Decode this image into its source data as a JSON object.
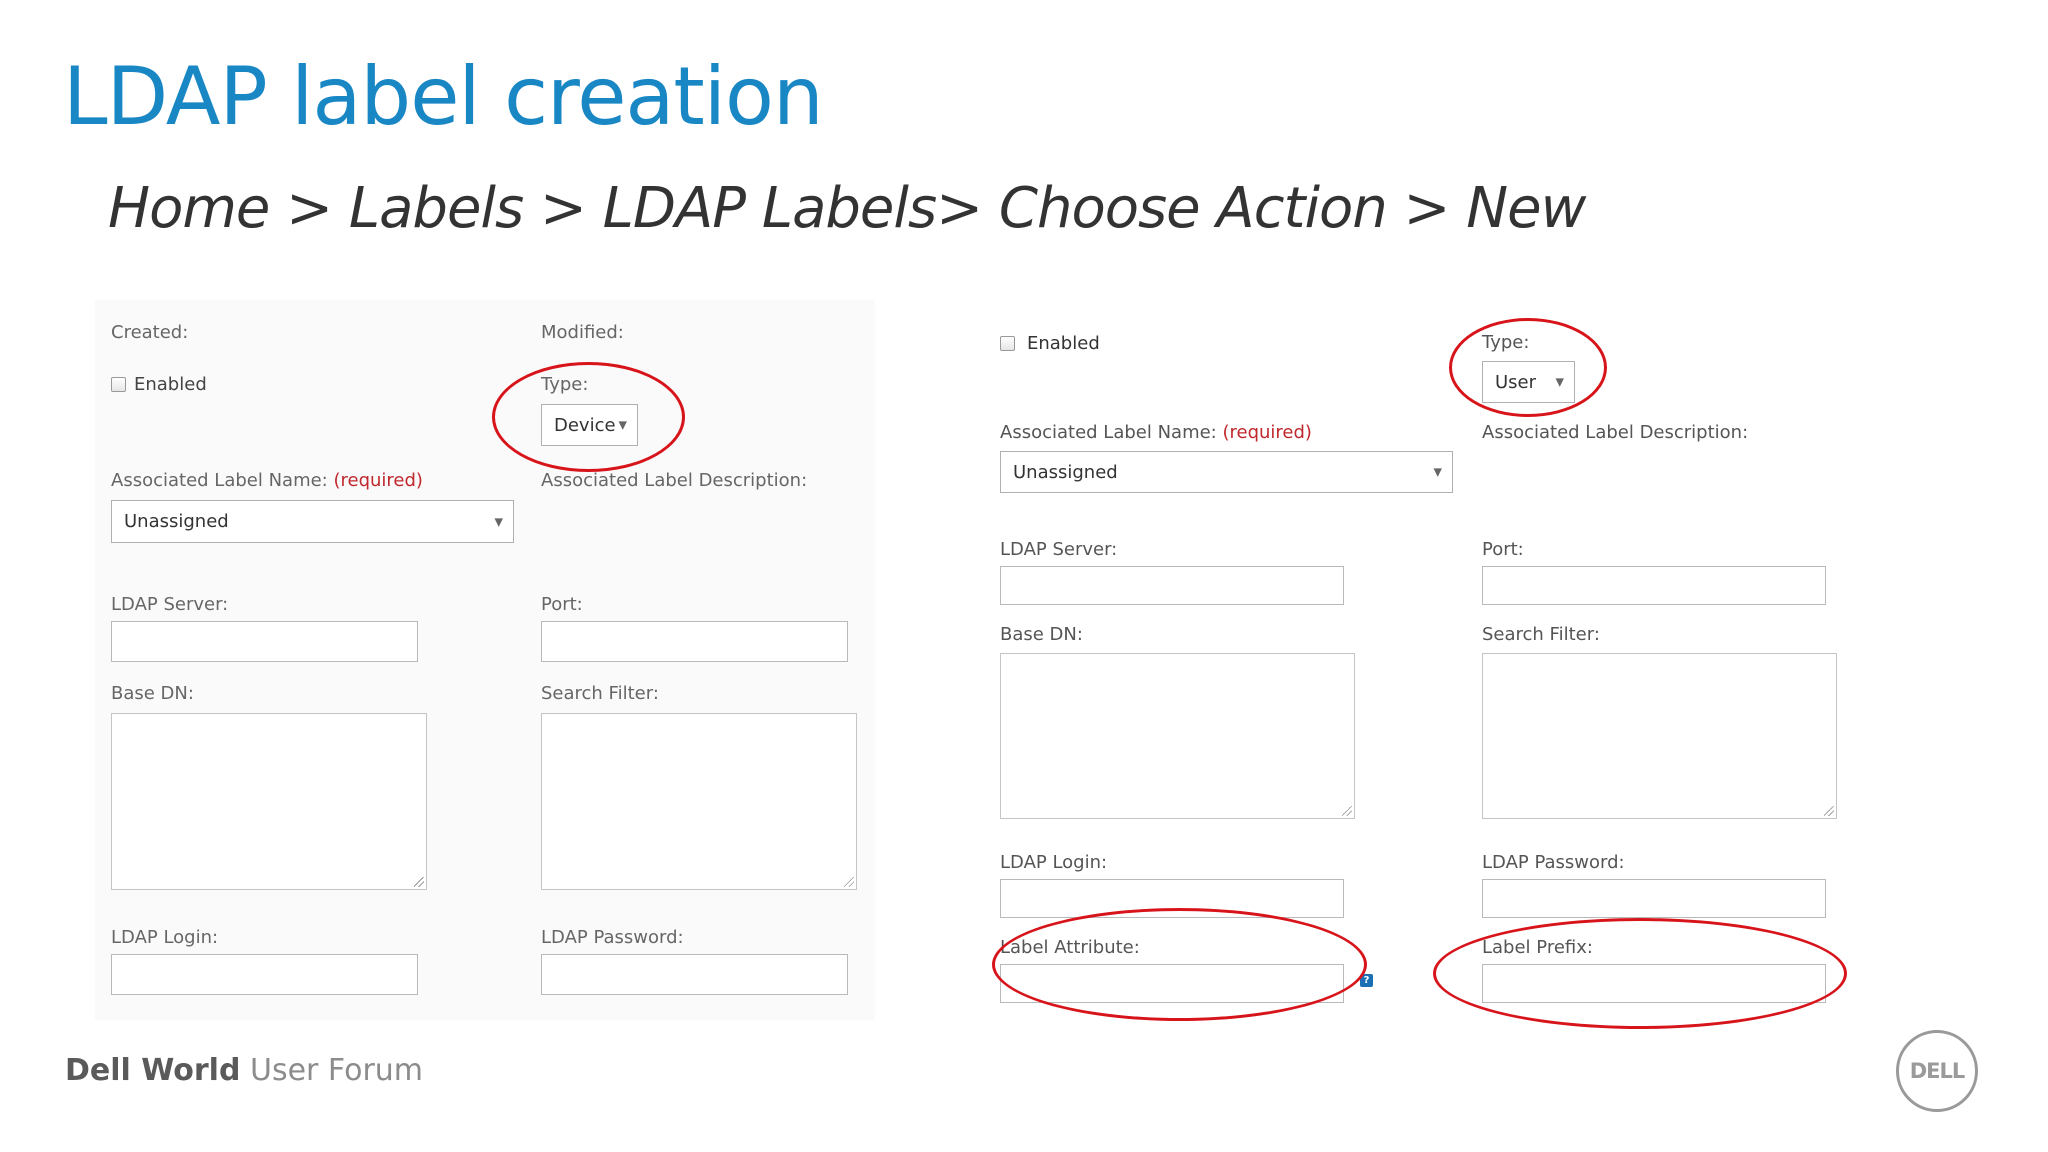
{
  "slide": {
    "title": "LDAP label creation",
    "breadcrumb": "Home > Labels > LDAP Labels> Choose Action > New"
  },
  "left_form": {
    "created_label": "Created:",
    "modified_label": "Modified:",
    "enabled_label": "Enabled",
    "type_label": "Type:",
    "type_value": "Device",
    "assoc_name_label": "Associated Label Name:",
    "required_text": "(required)",
    "assoc_desc_label": "Associated Label Description:",
    "assoc_name_value": "Unassigned",
    "ldap_server_label": "LDAP Server:",
    "port_label": "Port:",
    "base_dn_label": "Base DN:",
    "search_filter_label": "Search Filter:",
    "ldap_login_label": "LDAP Login:",
    "ldap_password_label": "LDAP Password:"
  },
  "right_form": {
    "enabled_label": "Enabled",
    "type_label": "Type:",
    "type_value": "User",
    "assoc_name_label": "Associated Label Name:",
    "required_text": "(required)",
    "assoc_desc_label": "Associated Label Description:",
    "assoc_name_value": "Unassigned",
    "ldap_server_label": "LDAP Server:",
    "port_label": "Port:",
    "base_dn_label": "Base DN:",
    "search_filter_label": "Search Filter:",
    "ldap_login_label": "LDAP Login:",
    "ldap_password_label": "LDAP Password:",
    "label_attribute_label": "Label Attribute:",
    "label_prefix_label": "Label Prefix:",
    "help_glyph": "?"
  },
  "footer": {
    "brand_bold": "Dell World",
    "brand_light": "User Forum",
    "logo_text": "DELL"
  },
  "colors": {
    "title": "#1a87c5",
    "highlight_circle": "#d8141b",
    "required": "#c0282d"
  },
  "icons": [
    "checkbox-icon",
    "dropdown-caret-icon",
    "resize-grip-icon",
    "help-icon"
  ]
}
